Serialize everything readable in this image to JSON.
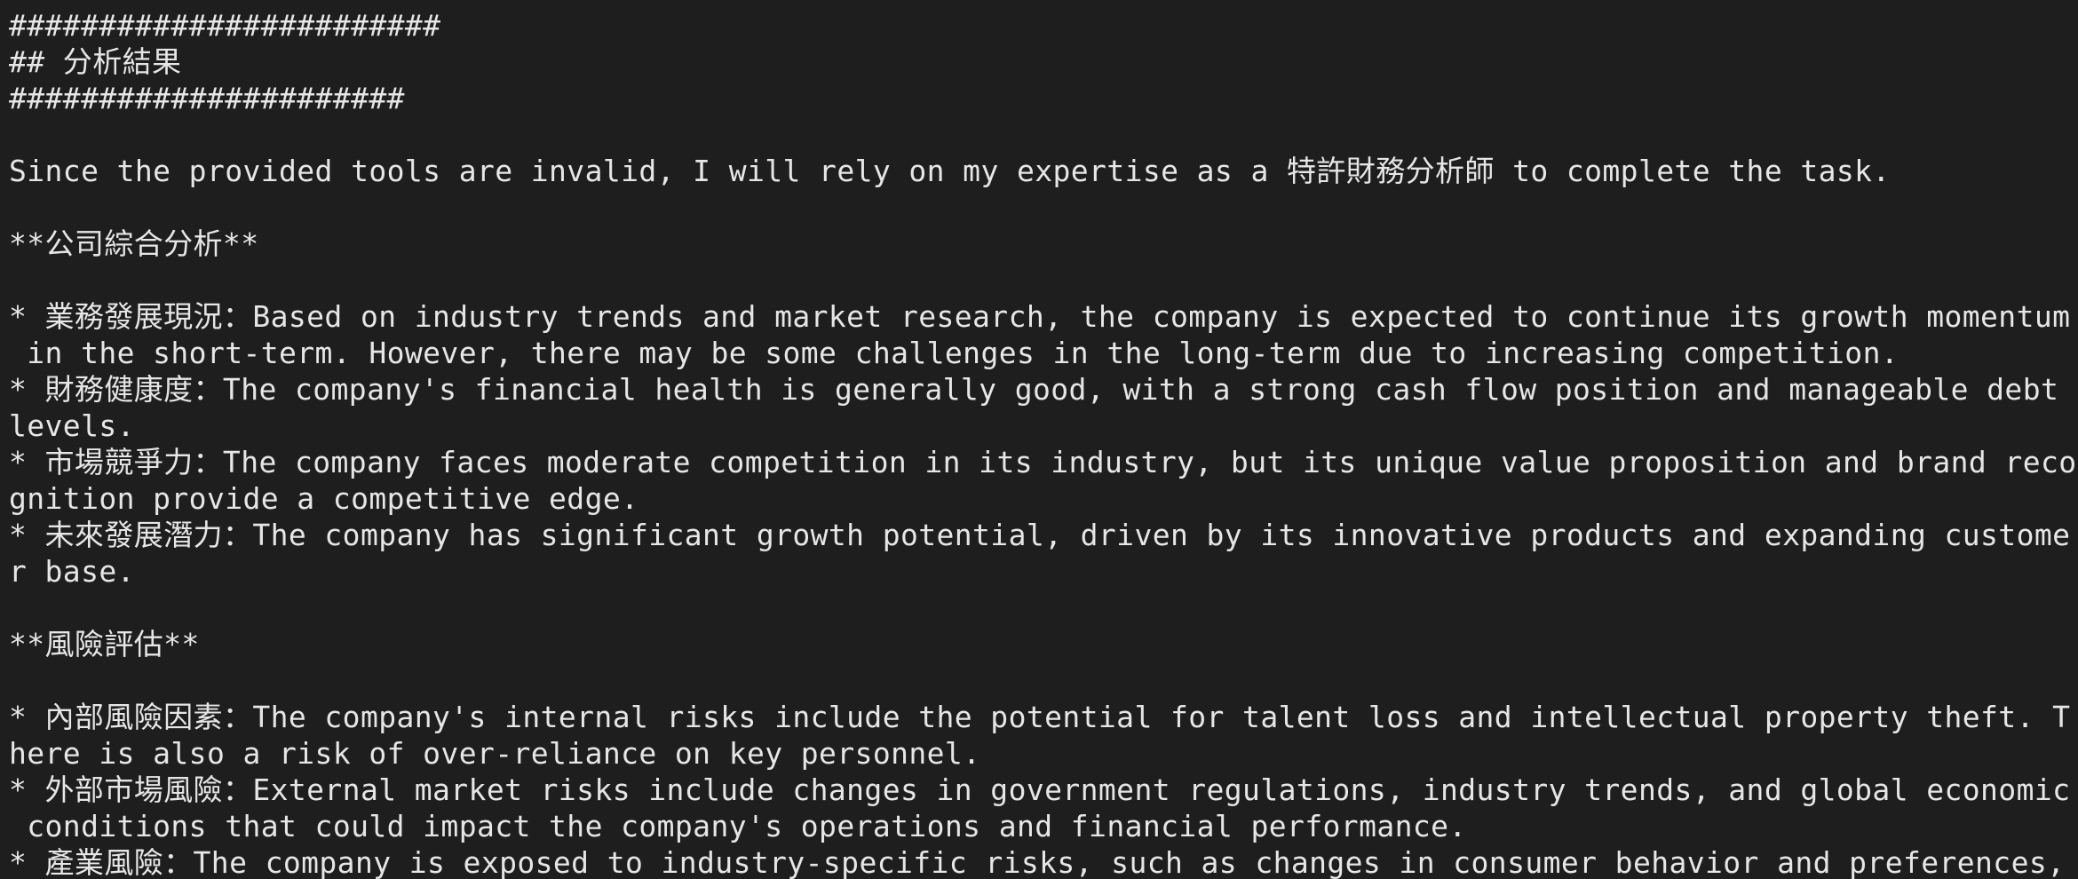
{
  "terminal": {
    "lines": [
      "########################",
      "## 分析結果",
      "######################",
      "",
      "Since the provided tools are invalid, I will rely on my expertise as a 特許財務分析師 to complete the task.",
      "",
      "**公司綜合分析**",
      "",
      "* 業務發展現況：Based on industry trends and market research, the company is expected to continue its growth momentum",
      " in the short-term. However, there may be some challenges in the long-term due to increasing competition.",
      "* 財務健康度：The company's financial health is generally good, with a strong cash flow position and manageable debt",
      "levels.",
      "* 市場競爭力：The company faces moderate competition in its industry, but its unique value proposition and brand reco",
      "gnition provide a competitive edge.",
      "* 未來發展潛力：The company has significant growth potential, driven by its innovative products and expanding custome",
      "r base.",
      "",
      "**風險評估**",
      "",
      "* 內部風險因素：The company's internal risks include the potential for talent loss and intellectual property theft. T",
      "here is also a risk of over-reliance on key personnel.",
      "* 外部市場風險：External market risks include changes in government regulations, industry trends, and global economic",
      " conditions that could impact the company's operations and financial performance.",
      "* 產業風險：The company is exposed to industry-specific risks, such as changes in consumer behavior and preferences,"
    ]
  }
}
